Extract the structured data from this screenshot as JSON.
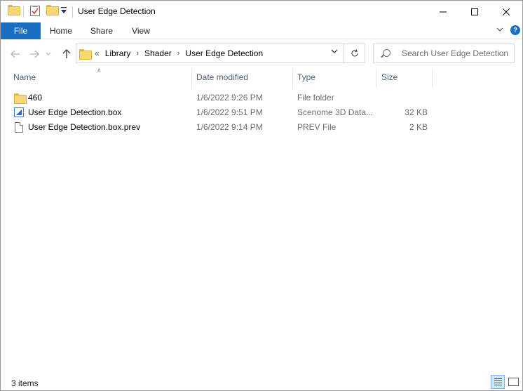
{
  "window": {
    "title": "User Edge Detection"
  },
  "ribbon": {
    "tabs": [
      "File",
      "Home",
      "Share",
      "View"
    ]
  },
  "address": {
    "prefix": "«",
    "crumbs": [
      "Library",
      "Shader",
      "User Edge Detection"
    ]
  },
  "search": {
    "placeholder": "Search User Edge Detection"
  },
  "columns": {
    "name": "Name",
    "date": "Date modified",
    "type": "Type",
    "size": "Size"
  },
  "files": [
    {
      "name": "460",
      "date": "1/6/2022 9:26 PM",
      "type": "File folder",
      "size": "",
      "icon": "folder-icon"
    },
    {
      "name": "User Edge Detection.box",
      "date": "1/6/2022 9:51 PM",
      "type": "Scenome 3D Data...",
      "size": "32 KB",
      "icon": "box-file-icon"
    },
    {
      "name": "User Edge Detection.box.prev",
      "date": "1/6/2022 9:14 PM",
      "type": "PREV File",
      "size": "2 KB",
      "icon": "document-icon"
    }
  ],
  "status": {
    "items": "3 items"
  },
  "colors": {
    "accent": "#1a6fc3",
    "header_text": "#4c607a",
    "secondary_text": "#6d6d6d"
  }
}
